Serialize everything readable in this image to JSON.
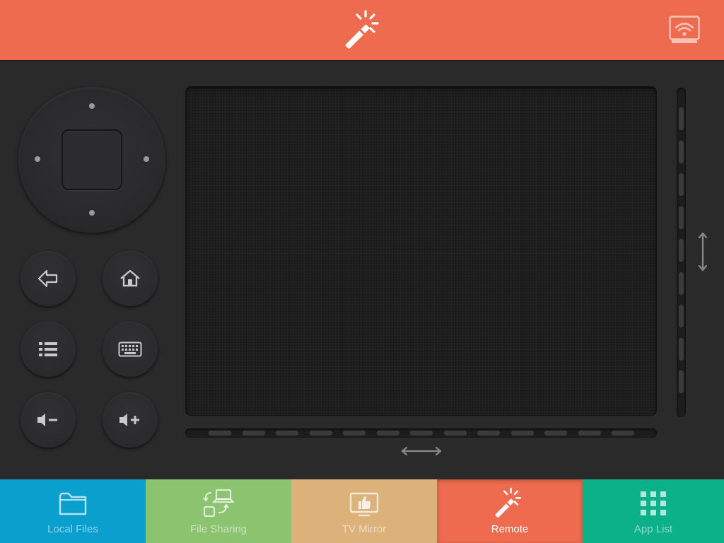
{
  "header": {
    "logo_icon": "magic-wand-icon",
    "cast_icon": "wireless-display-icon",
    "color": "#ee6b4f"
  },
  "remote": {
    "dpad_icon": "directional-pad",
    "buttons": [
      {
        "name": "back",
        "icon": "back-arrow-icon"
      },
      {
        "name": "home",
        "icon": "home-icon"
      },
      {
        "name": "menu",
        "icon": "list-icon"
      },
      {
        "name": "keyboard",
        "icon": "keyboard-icon"
      },
      {
        "name": "volume-down",
        "icon": "volume-down-icon"
      },
      {
        "name": "volume-up",
        "icon": "volume-up-icon"
      }
    ],
    "vertical_scroll_icon": "vertical-double-arrow-icon",
    "horizontal_scroll_icon": "horizontal-double-arrow-icon"
  },
  "tabs": [
    {
      "label": "Local Files",
      "icon": "folder-icon",
      "color": "#0b9fce",
      "active": false
    },
    {
      "label": "File Sharing",
      "icon": "file-sharing-icon",
      "color": "#8cc36f",
      "active": false
    },
    {
      "label": "TV Mirror",
      "icon": "tv-mirror-icon",
      "color": "#dcb27a",
      "active": false
    },
    {
      "label": "Remote",
      "icon": "magic-wand-icon",
      "color": "#ee6b4f",
      "active": true
    },
    {
      "label": "App List",
      "icon": "app-grid-icon",
      "color": "#0cb089",
      "active": false
    }
  ]
}
